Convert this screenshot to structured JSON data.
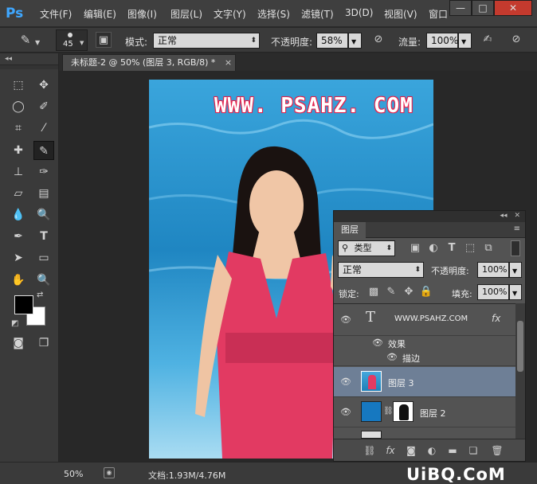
{
  "app": {
    "logo": "Ps"
  },
  "menu": {
    "items": [
      "文件(F)",
      "编辑(E)",
      "图像(I)",
      "图层(L)",
      "文字(Y)",
      "选择(S)",
      "滤镜(T)",
      "3D(D)",
      "视图(V)",
      "窗口"
    ]
  },
  "window": {
    "min": "—",
    "max": "□",
    "close": "✕"
  },
  "options": {
    "brush_size": "45",
    "mode_label": "模式:",
    "mode_value": "正常",
    "opacity_label": "不透明度:",
    "opacity_value": "58%",
    "flow_label": "流量:",
    "flow_value": "100%"
  },
  "document": {
    "tab_title": "未标题-2 @ 50% (图层 3, RGB/8) *",
    "close": "×",
    "watermark": "WWW. PSAHZ. COM"
  },
  "status": {
    "zoom": "50%",
    "doc_info": "文档:1.93M/4.76M"
  },
  "site_watermark": "UiBQ.CoM",
  "layers_panel": {
    "title": "图层",
    "collapse": "◂◂",
    "close": "✕",
    "filter_label": "类型",
    "blend_mode": "正常",
    "opacity_label": "不透明度:",
    "opacity_value": "100%",
    "lock_label": "锁定:",
    "fill_label": "填充:",
    "fill_value": "100%",
    "layers": [
      {
        "name": "WWW.PSAHZ.COM",
        "kind": "text",
        "fx": "fx"
      },
      {
        "name": "效果",
        "kind": "effect"
      },
      {
        "name": "描边",
        "kind": "effect-item"
      },
      {
        "name": "图层 3",
        "kind": "pixel",
        "selected": true
      },
      {
        "name": "图层 2",
        "kind": "masked"
      }
    ]
  },
  "colors": {
    "accent": "#3fa7ff",
    "selected_layer": "#6e7f96",
    "foreground": "#000000",
    "background": "#ffffff"
  }
}
